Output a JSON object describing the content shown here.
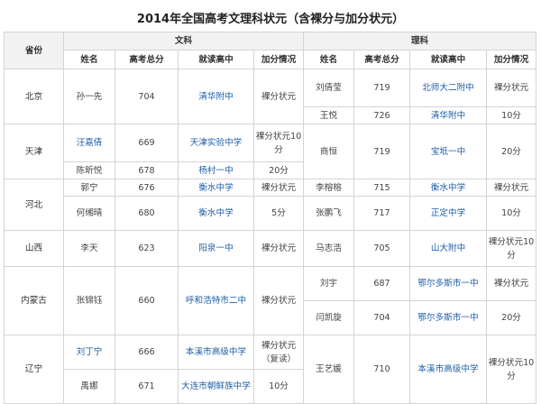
{
  "page_title": "2014年全国高考文理科状元（含裸分与加分状元）",
  "accent_link_color": "#1f5fa8",
  "headers": {
    "province": "省份",
    "wen": "文科",
    "li": "理科",
    "name": "姓名",
    "score": "高考总分",
    "school": "就读高中",
    "bonus": "加分情况"
  },
  "rows": {
    "beijing": {
      "province": "北京",
      "wen": {
        "name": "孙一先",
        "score": "704",
        "school": "清华附中",
        "bonus": "裸分状元"
      },
      "li1": {
        "name": "刘倩莹",
        "score": "719",
        "school": "北师大二附中",
        "bonus": "裸分状元"
      },
      "li2": {
        "name": "王悦",
        "score": "726",
        "school": "清华附中",
        "bonus": "10分"
      }
    },
    "tianjin": {
      "province": "天津",
      "wen1": {
        "name": "汪嘉倩",
        "score": "669",
        "school": "天津实验中学",
        "bonus": "裸分状元10分"
      },
      "wen2": {
        "name": "陈昕悦",
        "score": "678",
        "school": "杨村一中",
        "bonus": "20分"
      },
      "li": {
        "name": "商恒",
        "score": "719",
        "school": "宝坻一中",
        "bonus": "20分"
      }
    },
    "hebei": {
      "province": "河北",
      "wen1": {
        "name": "郭宁",
        "score": "676",
        "school": "衡水中学",
        "bonus": "裸分状元"
      },
      "wen2": {
        "name": "何缃晴",
        "score": "680",
        "school": "衡水中学",
        "bonus": "5分"
      },
      "li1": {
        "name": "李榕榕",
        "score": "715",
        "school": "衡水中学",
        "bonus": "裸分状元"
      },
      "li2": {
        "name": "张鹏飞",
        "score": "717",
        "school": "正定中学",
        "bonus": "10分"
      }
    },
    "shanxi": {
      "province": "山西",
      "wen": {
        "name": "李天",
        "score": "623",
        "school": "阳泉一中",
        "bonus": "裸分状元"
      },
      "li": {
        "name": "马志浩",
        "score": "705",
        "school": "山大附中",
        "bonus": "裸分状元10分"
      }
    },
    "neimenggu": {
      "province": "内蒙古",
      "wen": {
        "name": "张锦钰",
        "score": "660",
        "school": "呼和浩特市二中",
        "bonus": "裸分状元"
      },
      "li1": {
        "name": "刘宇",
        "score": "687",
        "school": "鄂尔多斯市一中",
        "bonus": "裸分状元"
      },
      "li2": {
        "name": "闫凯旋",
        "score": "704",
        "school": "鄂尔多斯市一中",
        "bonus": "20分"
      }
    },
    "liaoning": {
      "province": "辽宁",
      "wen1": {
        "name": "刘丁宁",
        "score": "666",
        "school": "本溪市高级中学",
        "bonus": "裸分状元（复读）"
      },
      "wen2": {
        "name": "禹娜",
        "score": "671",
        "school": "大连市朝鲜族中学",
        "bonus": "10分"
      },
      "li": {
        "name": "王艺媛",
        "score": "710",
        "school": "本溪市高级中学",
        "bonus": "裸分状元10分"
      }
    }
  }
}
